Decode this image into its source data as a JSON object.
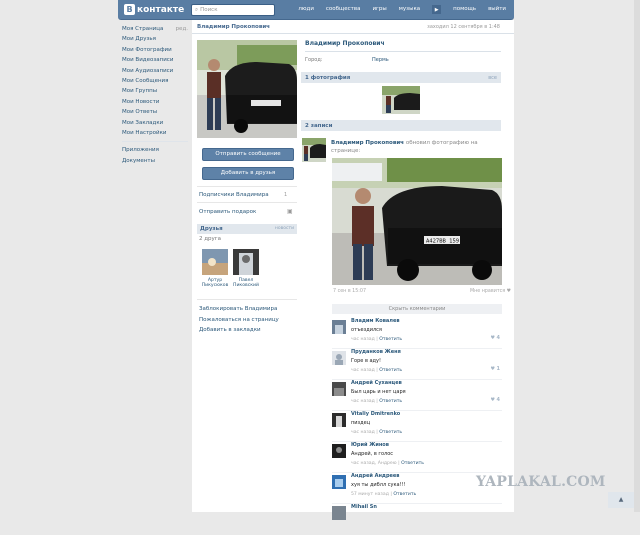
{
  "header": {
    "logo_mark": "B",
    "logo_text": "контакте",
    "search_placeholder": "Поиск",
    "nav": [
      "люди",
      "сообщества",
      "игры",
      "музыка",
      "помощь",
      "выйти"
    ]
  },
  "left_menu": {
    "items": [
      "Моя Страница",
      "Мои Друзья",
      "Мои Фотографии",
      "Мои Видеозаписи",
      "Мои Аудиозаписи",
      "Мои Сообщения",
      "Мои Группы",
      "Мои Новости",
      "Мои Ответы",
      "Мои Закладки",
      "Мои Настройки"
    ],
    "edit_label": "ред.",
    "extra": [
      "Приложения",
      "Документы"
    ]
  },
  "profile": {
    "name": "Владимир Прокопович",
    "status": "заходил 12 сентября в 1:48",
    "send_message": "Отправить сообщение",
    "add_friend": "Добавить в друзья",
    "subscribers": "Подписчики Владимира",
    "subscribers_count": "1",
    "gift": "Отправить подарок",
    "friends_title": "Друзья",
    "friends_news": "новости",
    "friends_count": "2 друга",
    "friends": [
      {
        "first": "Артур",
        "last": "Пикусюков"
      },
      {
        "first": "Павел",
        "last": "Пиковский"
      }
    ],
    "actions": [
      "Заблокировать Владимира",
      "Пожаловаться на страницу",
      "Добавить в закладки"
    ],
    "city_label": "Город:",
    "city_value": "Пермь",
    "photos_title": "1 фотография",
    "photos_all": "все",
    "posts_title": "2 записи"
  },
  "post": {
    "author": "Владимир Прокопович",
    "action": "обновил фотографию на странице:",
    "plate": "А427ВВ 159",
    "time": "7 сен в 15:07",
    "like": "Мне нравится",
    "hide_comments": "Скрыть комментарии"
  },
  "comments": [
    {
      "name": "Владим Ковалев",
      "text": "отъездился",
      "time": "час назад",
      "reply": "Ответить",
      "likes": "4"
    },
    {
      "name": "Пруданков Женя",
      "text": "Горе в аду!",
      "time": "час назад",
      "reply": "Ответить",
      "likes": "1"
    },
    {
      "name": "Андрей Суханцев",
      "text": "Был царь и нет царя",
      "time": "час назад",
      "reply": "Ответить",
      "likes": "4"
    },
    {
      "name": "Vitaliy Dmitrenko",
      "text": "пиздец",
      "time": "час назад",
      "reply": "Ответить",
      "likes": ""
    },
    {
      "name": "Юрий Жинов",
      "text": "Андрей, в голос",
      "time": "час назад, Андрею",
      "reply": "Ответить",
      "likes": ""
    },
    {
      "name": "Андрей Андреев",
      "text": "хуя ты диблл сука!!!",
      "time": "57 минут назад",
      "reply": "Ответить",
      "likes": ""
    },
    {
      "name": "Mihail Sn",
      "text": "",
      "time": "",
      "reply": "",
      "likes": ""
    }
  ],
  "watermark": "YAPLAKAL.COM",
  "upbtn": "▲"
}
